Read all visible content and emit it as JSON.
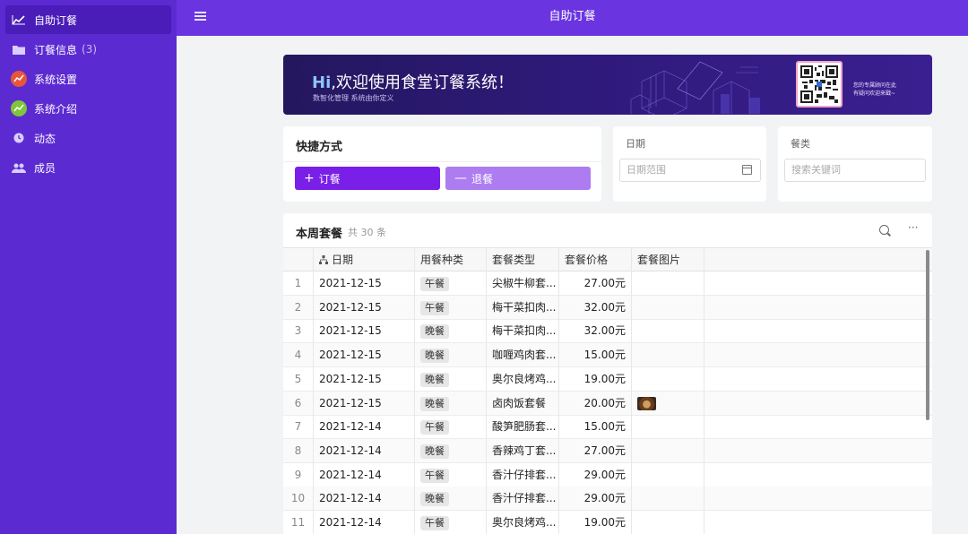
{
  "sidebar": {
    "items": [
      {
        "label": "自助订餐",
        "icon": "trend-icon",
        "count": ""
      },
      {
        "label": "订餐信息",
        "icon": "folder-icon",
        "count": "(3)"
      },
      {
        "label": "系统设置",
        "icon": "settings-icon",
        "count": ""
      },
      {
        "label": "系统介绍",
        "icon": "info-icon",
        "count": ""
      },
      {
        "label": "动态",
        "icon": "clock-icon",
        "count": ""
      },
      {
        "label": "成员",
        "icon": "members-icon",
        "count": ""
      }
    ]
  },
  "header": {
    "title": "自助订餐"
  },
  "banner": {
    "hi": "Hi",
    "title": ",欢迎使用食堂订餐系统！",
    "subtitle": "数智化管理 系统由你定义",
    "note_line1": "您的专属顾问在此",
    "note_line2": "有疑问欢迎来戳~"
  },
  "quick": {
    "title": "快捷方式",
    "order_label": "订餐",
    "cancel_label": "退餐"
  },
  "date_filter": {
    "label": "日期",
    "placeholder": "日期范围"
  },
  "kind_filter": {
    "label": "餐类",
    "placeholder": "搜索关键词"
  },
  "table": {
    "title": "本周套餐",
    "count": "共 30 条",
    "columns": [
      "日期",
      "用餐种类",
      "套餐类型",
      "套餐价格",
      "套餐图片"
    ],
    "rows": [
      {
        "no": "1",
        "date": "2021-12-15",
        "meal": "午餐",
        "type": "尖椒牛柳套...",
        "price": "27.00元",
        "img": false
      },
      {
        "no": "2",
        "date": "2021-12-15",
        "meal": "午餐",
        "type": "梅干菜扣肉...",
        "price": "32.00元",
        "img": false
      },
      {
        "no": "3",
        "date": "2021-12-15",
        "meal": "晚餐",
        "type": "梅干菜扣肉...",
        "price": "32.00元",
        "img": false
      },
      {
        "no": "4",
        "date": "2021-12-15",
        "meal": "晚餐",
        "type": "咖喱鸡肉套...",
        "price": "15.00元",
        "img": false
      },
      {
        "no": "5",
        "date": "2021-12-15",
        "meal": "晚餐",
        "type": "奥尔良烤鸡...",
        "price": "19.00元",
        "img": false
      },
      {
        "no": "6",
        "date": "2021-12-15",
        "meal": "晚餐",
        "type": "卤肉饭套餐",
        "price": "20.00元",
        "img": true
      },
      {
        "no": "7",
        "date": "2021-12-14",
        "meal": "午餐",
        "type": "酸笋肥肠套...",
        "price": "15.00元",
        "img": false
      },
      {
        "no": "8",
        "date": "2021-12-14",
        "meal": "晚餐",
        "type": "香辣鸡丁套...",
        "price": "27.00元",
        "img": false
      },
      {
        "no": "9",
        "date": "2021-12-14",
        "meal": "午餐",
        "type": "香汁仔排套...",
        "price": "29.00元",
        "img": false
      },
      {
        "no": "10",
        "date": "2021-12-14",
        "meal": "晚餐",
        "type": "香汁仔排套...",
        "price": "29.00元",
        "img": false
      },
      {
        "no": "11",
        "date": "2021-12-14",
        "meal": "午餐",
        "type": "奥尔良烤鸡...",
        "price": "19.00元",
        "img": false
      }
    ]
  },
  "colors": {
    "sidebar": "#5b2ad1",
    "header": "#6a35e0",
    "primary": "#7a1fe8",
    "secondary": "#ad7cf0"
  }
}
